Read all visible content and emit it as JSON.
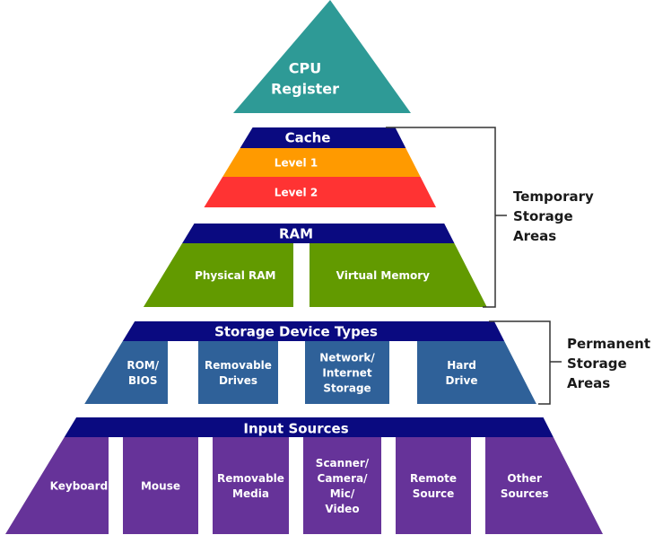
{
  "colors": {
    "cpu": "#2e9a96",
    "header": "#0a0a80",
    "level1": "#ff9a00",
    "level2": "#ff3333",
    "ram": "#629a00",
    "storage": "#2f6199",
    "input": "#663399",
    "label": "#ffffff",
    "bracket": "#333333",
    "side_text": "#1a1a1a"
  },
  "cpu": {
    "lines": [
      "CPU",
      "Register"
    ]
  },
  "cache": {
    "header": "Cache",
    "levels": [
      {
        "label": "Level 1",
        "color_key": "level1"
      },
      {
        "label": "Level 2",
        "color_key": "level2"
      }
    ]
  },
  "ram": {
    "header": "RAM",
    "items": [
      {
        "lines": [
          "Physical RAM"
        ]
      },
      {
        "lines": [
          "Virtual Memory"
        ]
      }
    ]
  },
  "storage": {
    "header": "Storage Device Types",
    "items": [
      {
        "lines": [
          "ROM/",
          "BIOS"
        ]
      },
      {
        "lines": [
          "Removable",
          "Drives"
        ]
      },
      {
        "lines": [
          "Network/",
          "Internet",
          "Storage"
        ]
      },
      {
        "lines": [
          "Hard",
          "Drive"
        ]
      }
    ]
  },
  "input": {
    "header": "Input Sources",
    "items": [
      {
        "lines": [
          "Keyboard"
        ]
      },
      {
        "lines": [
          "Mouse"
        ]
      },
      {
        "lines": [
          "Removable",
          "Media"
        ]
      },
      {
        "lines": [
          "Scanner/",
          "Camera/",
          "Mic/",
          "Video"
        ]
      },
      {
        "lines": [
          "Remote",
          "Source"
        ]
      },
      {
        "lines": [
          "Other",
          "Sources"
        ]
      }
    ]
  },
  "brackets": {
    "temporary": {
      "lines": [
        "Temporary",
        "Storage",
        "Areas"
      ]
    },
    "permanent": {
      "lines": [
        "Permanent",
        "Storage",
        "Areas"
      ]
    }
  }
}
